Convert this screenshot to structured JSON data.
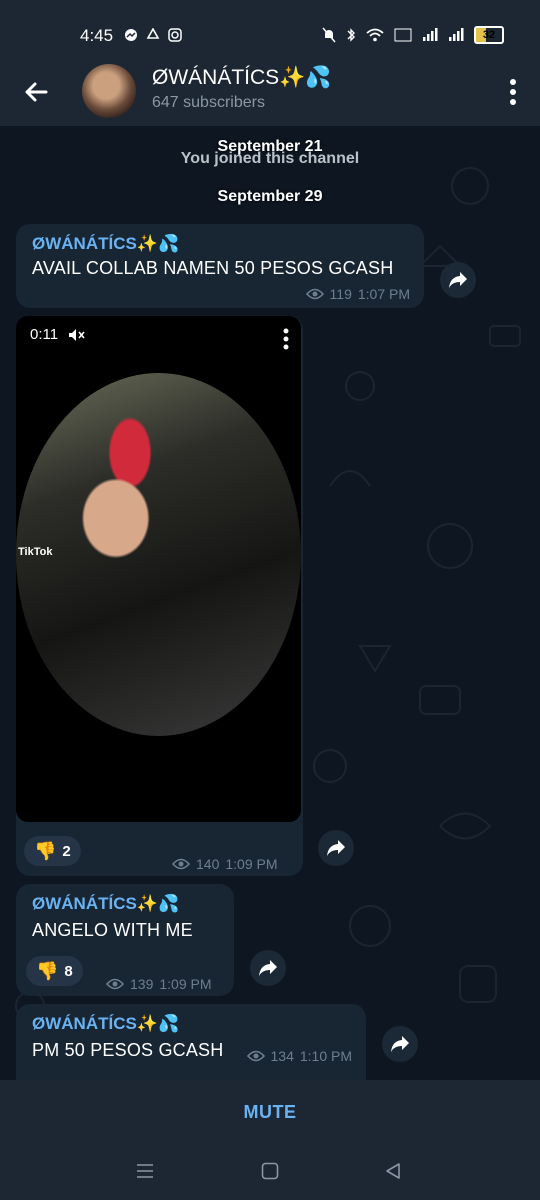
{
  "status_bar": {
    "time": "4:45",
    "battery": "32",
    "left_icons": [
      "messenger-icon",
      "sync-icon",
      "instagram-icon"
    ],
    "right_icons": [
      "bell-off-icon",
      "bluetooth-icon",
      "wifi-icon",
      "volte-icon",
      "signal-icon",
      "signal-icon",
      "battery-icon"
    ]
  },
  "header": {
    "title": "ØWÁNÁTÍCS✨💦",
    "subtitle": "647 subscribers"
  },
  "chat": {
    "date_1": "September 21",
    "service_1": "You joined this channel",
    "date_2": "September 29",
    "messages": [
      {
        "sender": "ØWÁNÁTÍCS✨💦",
        "text": "AVAIL COLLAB NAMEN 50 PESOS GCASH",
        "views": "119",
        "time": "1:07 PM"
      },
      {
        "type": "video",
        "duration": "0:11",
        "watermark": "TikTok",
        "reaction": "👎",
        "reaction_count": "2",
        "views": "140",
        "time": "1:09 PM"
      },
      {
        "sender": "ØWÁNÁTÍCS✨💦",
        "text": "ANGELO WITH ME",
        "reaction": "👎",
        "reaction_count": "8",
        "views": "139",
        "time": "1:09 PM"
      },
      {
        "sender": "ØWÁNÁTÍCS✨💦",
        "text": "PM 50 PESOS GCASH",
        "views": "134",
        "time": "1:10 PM"
      }
    ]
  },
  "bottom": {
    "mute_label": "MUTE"
  },
  "colors": {
    "accent": "#6ab3f3",
    "bubble": "#182533",
    "background": "#0e1621",
    "bar": "#1d2733"
  }
}
